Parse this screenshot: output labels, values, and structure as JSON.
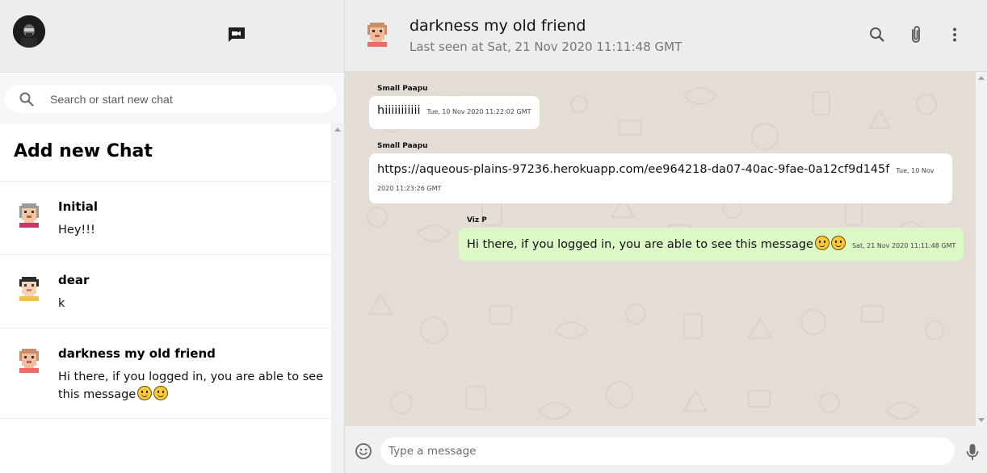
{
  "sidebar": {
    "search": {
      "placeholder": "Search or start new chat"
    },
    "add_chat_label": "Add new Chat",
    "chats": [
      {
        "name": "Initial",
        "last_message": "Hey!!!",
        "avatar": "pixel-avatar-grey-hair"
      },
      {
        "name": "dear",
        "last_message": "k",
        "avatar": "pixel-avatar-dark-hair"
      },
      {
        "name": "darkness my old friend",
        "last_message": "Hi there, if you logged in, you are able to see this message",
        "emoji_count": 2,
        "avatar": "pixel-avatar-brown-hair"
      }
    ]
  },
  "chat": {
    "contact_name": "darkness my old friend",
    "last_seen": "Last seen at Sat, 21 Nov 2020 11:11:48 GMT",
    "messages": [
      {
        "sender": "Small Paapu",
        "text": "hiiiiiiiiiii",
        "timestamp": "Tue, 10 Nov 2020 11:22:02 GMT",
        "mine": false
      },
      {
        "sender": "Small Paapu",
        "text": "https://aqueous-plains-97236.herokuapp.com/ee964218-da07-40ac-9fae-0a12cf9d145f",
        "timestamp": "Tue, 10 Nov 2020 11:23:26 GMT",
        "mine": false
      },
      {
        "sender": "Viz P",
        "text": "Hi there, if you logged in, you are able to see this message",
        "emoji_count": 2,
        "timestamp": "Sat, 21 Nov 2020 11:11:48 GMT",
        "mine": true
      }
    ],
    "input_placeholder": "Type a message"
  },
  "icons": [
    "search-icon",
    "new-chat-icon",
    "attach-icon",
    "more-options-icon",
    "emoji-icon",
    "mic-icon"
  ],
  "colors": {
    "header_bg": "#ededed",
    "chat_bg": "#e4ddd6",
    "outgoing_bubble": "#dcf8c6",
    "incoming_bubble": "#ffffff"
  }
}
